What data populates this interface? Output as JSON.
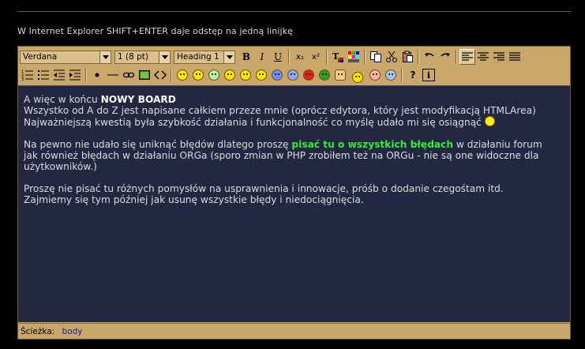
{
  "hint": "W Internet Explorer SHIFT+ENTER daje odstęp na jedną linijkę",
  "toolbar": {
    "font_family": "Verdana",
    "font_size": "1 (8 pt)",
    "format_block": "Heading 1",
    "bold_label": "B",
    "italic_label": "I",
    "underline_label": "U",
    "subscript_label": "x₂",
    "superscript_label": "x²",
    "help_label": "?",
    "info_label": "i"
  },
  "content": {
    "line1_prefix": "A więc w końcu ",
    "line1_bold": "NOWY BOARD",
    "line2": "Wszystko od A do Z jest napisane całkiem przeze mnie (oprócz edytora, który jest modyfikacją HTMLArea)",
    "line3": "Najważniejszą kwestią była szybkość działania i funkcjonalność co myślę udało mi się osiągnąć ",
    "para2_prefix": "Na pewno nie udało się uniknąć błędów dlatego proszę ",
    "para2_link": "pisać tu o wszystkich błędach",
    "para2_suffix": " w działaniu forum",
    "para2_line2": "jak również błędach w działaniu ORGa (sporo zmian w PHP zrobiłem też na ORGu - nie są one widoczne dla",
    "para2_line3": "użytkowników.)",
    "para3_line1": "Proszę nie pisać tu różnych pomysłów na usprawnienia i innowacje, próśb o dodanie czegośtam itd.",
    "para3_line2": "Zajmiemy się tym później jak usunę wszystkie błędy i niedociągnięcia."
  },
  "statusbar": {
    "label": "Ścieżka:",
    "path": "body"
  },
  "colors": {
    "toolbar_bg": "#c9a66a",
    "editor_bg": "#242742",
    "link_green": "#33ee33",
    "path_blue": "#1a1aa0"
  }
}
